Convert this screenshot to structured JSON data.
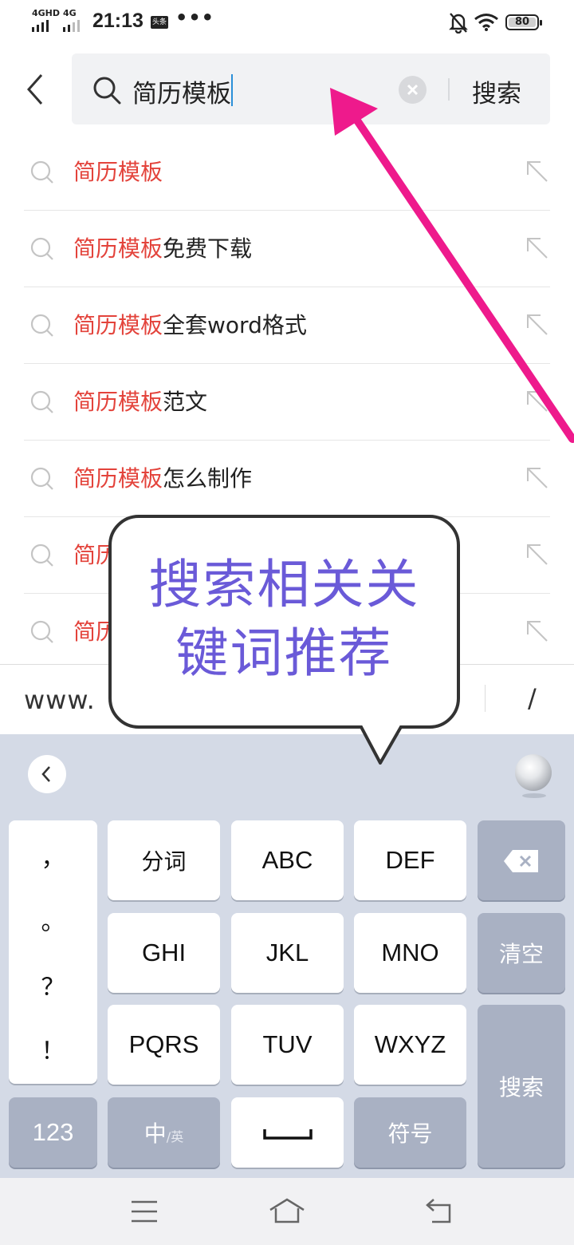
{
  "status_bar": {
    "network_1": "4GHD",
    "network_2": "4G",
    "time": "21:13",
    "app_badge": "头条",
    "more": "•••",
    "battery": "80"
  },
  "search": {
    "query": "简历模板",
    "action_label": "搜索"
  },
  "suggestions": [
    {
      "highlight": "简历模板",
      "rest": ""
    },
    {
      "highlight": "简历模板",
      "rest": "免费下载"
    },
    {
      "highlight": "简历模板",
      "rest": "全套word格式"
    },
    {
      "highlight": "简历模板",
      "rest": "范文"
    },
    {
      "highlight": "简历模板",
      "rest": "怎么制作"
    },
    {
      "highlight": "简历",
      "rest": ""
    },
    {
      "highlight": "简历",
      "rest": ""
    }
  ],
  "url_bar": {
    "prefix": "www.",
    "slash": "/"
  },
  "keyboard": {
    "punctuation": [
      "，",
      "。",
      "？",
      "！"
    ],
    "rows": [
      [
        "分词",
        "ABC",
        "DEF"
      ],
      [
        "GHI",
        "JKL",
        "MNO"
      ],
      [
        "PQRS",
        "TUV",
        "WXYZ"
      ]
    ],
    "clear_label": "清空",
    "search_label": "搜索",
    "num_label": "123",
    "lang_main": "中",
    "lang_sub": "/英",
    "symbol_label": "符号"
  },
  "callout": {
    "line1": "搜索相关关",
    "line2": "键词推荐"
  },
  "colors": {
    "highlight": "#e3433b",
    "arrow": "#ee1a8c",
    "callout_text": "#6a5ad8",
    "keyboard_bg": "#d4dae6"
  }
}
